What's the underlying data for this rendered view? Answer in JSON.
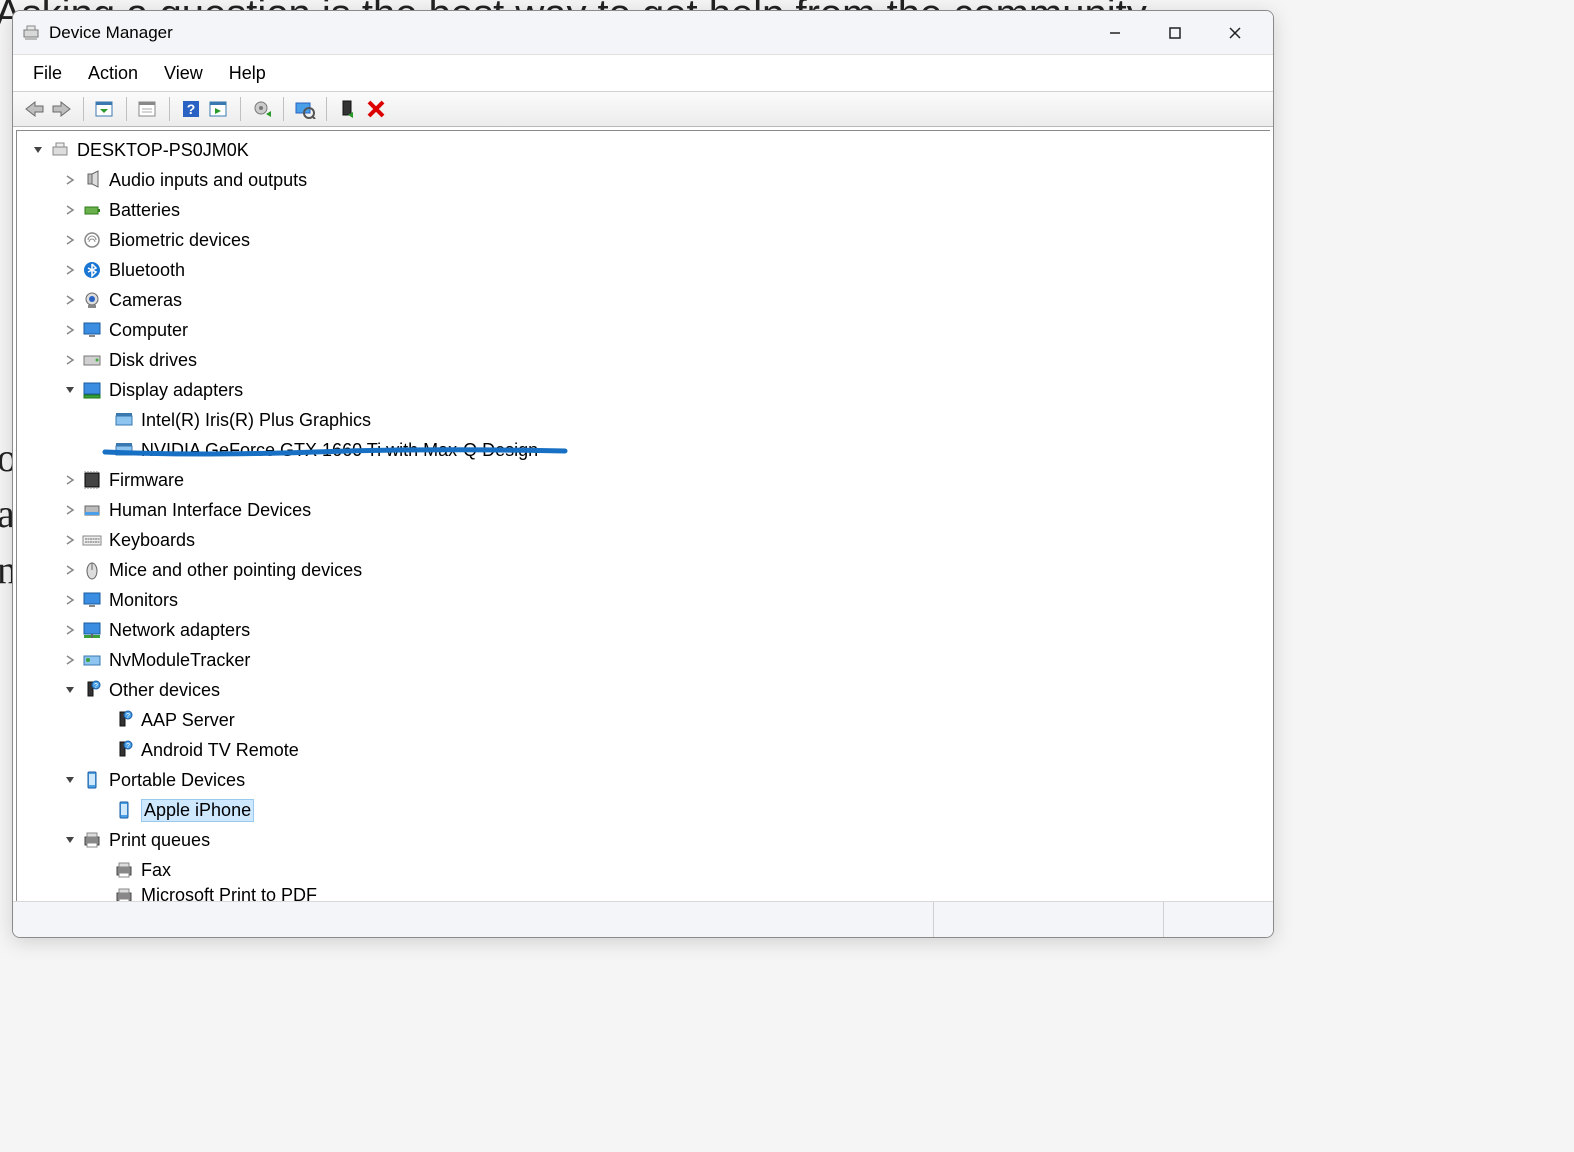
{
  "background_text": "Asking a question is the best way to get help from the community",
  "left_letters": [
    "o",
    "a",
    "n"
  ],
  "window": {
    "title": "Device Manager"
  },
  "menus": [
    "File",
    "Action",
    "View",
    "Help"
  ],
  "tree": {
    "root": "DESKTOP-PS0JM0K",
    "nodes": [
      {
        "label": "Audio inputs and outputs",
        "icon": "audio",
        "exp": "right"
      },
      {
        "label": "Batteries",
        "icon": "battery",
        "exp": "right"
      },
      {
        "label": "Biometric devices",
        "icon": "biometric",
        "exp": "right"
      },
      {
        "label": "Bluetooth",
        "icon": "bluetooth",
        "exp": "right"
      },
      {
        "label": "Cameras",
        "icon": "camera",
        "exp": "right"
      },
      {
        "label": "Computer",
        "icon": "monitor",
        "exp": "right"
      },
      {
        "label": "Disk drives",
        "icon": "disk",
        "exp": "right"
      },
      {
        "label": "Display adapters",
        "icon": "display",
        "exp": "down",
        "children": [
          {
            "label": "Intel(R) Iris(R) Plus Graphics",
            "icon": "display-card"
          },
          {
            "label": "NVIDIA GeForce GTX 1660 Ti with Max-Q Design",
            "icon": "display-card",
            "underlined": true
          }
        ]
      },
      {
        "label": "Firmware",
        "icon": "firmware",
        "exp": "right"
      },
      {
        "label": "Human Interface Devices",
        "icon": "hid",
        "exp": "right"
      },
      {
        "label": "Keyboards",
        "icon": "keyboard",
        "exp": "right"
      },
      {
        "label": "Mice and other pointing devices",
        "icon": "mouse",
        "exp": "right"
      },
      {
        "label": "Monitors",
        "icon": "monitor",
        "exp": "right"
      },
      {
        "label": "Network adapters",
        "icon": "network",
        "exp": "right"
      },
      {
        "label": "NvModuleTracker",
        "icon": "nvmod",
        "exp": "right"
      },
      {
        "label": "Other devices",
        "icon": "other",
        "exp": "down",
        "children": [
          {
            "label": "AAP Server",
            "icon": "other-warn"
          },
          {
            "label": "Android TV Remote",
            "icon": "other-warn"
          }
        ]
      },
      {
        "label": "Portable Devices",
        "icon": "portable",
        "exp": "down",
        "children": [
          {
            "label": "Apple iPhone",
            "icon": "portable",
            "selected": true
          }
        ]
      },
      {
        "label": "Print queues",
        "icon": "printer",
        "exp": "down",
        "children": [
          {
            "label": "Fax",
            "icon": "printer"
          },
          {
            "label": "Microsoft Print to PDF",
            "icon": "printer",
            "cut": true
          }
        ]
      }
    ]
  },
  "underline_color": "#1770c4"
}
